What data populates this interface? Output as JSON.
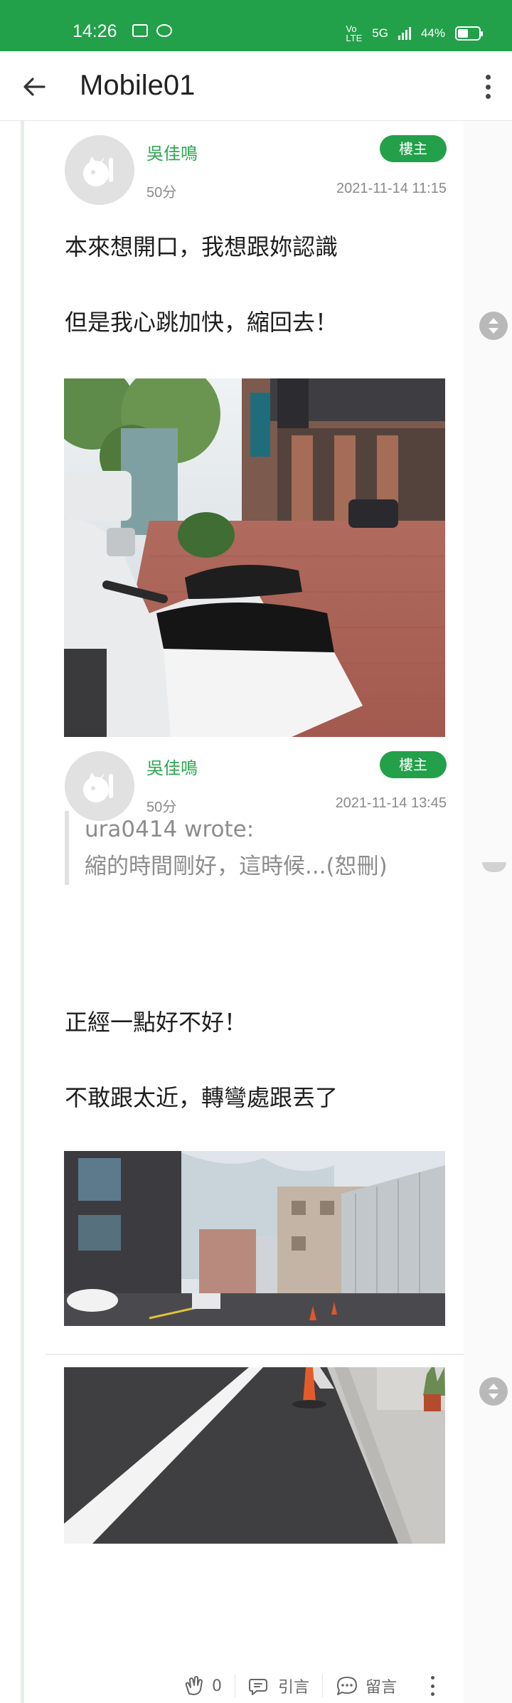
{
  "status_bar": {
    "time": "14:26",
    "network": "5G",
    "battery": "44%",
    "icons": [
      "notification-icon",
      "messenger-icon",
      "volte-icon",
      "signal-icon",
      "battery-icon"
    ]
  },
  "app_bar": {
    "title": "Mobile01",
    "back_icon": "arrow-left-icon",
    "menu_icon": "more-vertical-icon"
  },
  "posts": [
    {
      "author": "吳佳鳴",
      "level": "50分",
      "badge": "樓主",
      "date": "2021-11-14 11:15",
      "paragraphs": [
        "本來想開口，我想跟妳認識",
        "但是我心跳加快，縮回去！"
      ],
      "photo": "scooter-on-brick-sidewalk"
    },
    {
      "author": "吳佳鳴",
      "level": "50分",
      "badge": "樓主",
      "date": "2021-11-14 13:45",
      "quote": {
        "author": "ura0414 wrote:",
        "text": "縮的時間剛好，這時候...(恕刪)"
      },
      "paragraphs": [
        "正經一點好不好！",
        "不敢跟太近，轉彎處跟丟了"
      ],
      "photo": "street-with-traffic-cone"
    }
  ],
  "footer_actions": {
    "like_count": "0",
    "quote_label": "引言",
    "comment_label": "留言"
  },
  "colors": {
    "brand_green": "#23a04a",
    "author_green": "#2ea651",
    "meta_gray": "#8a8a8a"
  }
}
